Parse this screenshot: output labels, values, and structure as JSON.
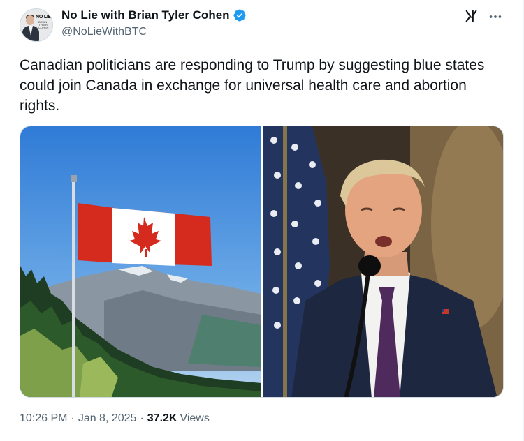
{
  "author": {
    "display_name": "No Lie with Brian Tyler Cohen",
    "handle": "@NoLieWithBTC",
    "avatar_text": "NO LIE",
    "avatar_subtext": "BRIAN TYLER COHEN",
    "verified": true
  },
  "tweet": {
    "text": "Canadian politicians are responding to Trump by suggesting blue states could join Canada in exchange for universal health care and abortion rights."
  },
  "media": {
    "images": [
      {
        "name": "canada-flag-photo",
        "description_icon": "canada-flag-mountains"
      },
      {
        "name": "trump-speaking-photo",
        "description_icon": "speaker-microphone"
      }
    ]
  },
  "meta": {
    "time": "10:26 PM",
    "date": "Jan 8, 2025",
    "views_count": "37.2K",
    "views_label": "Views"
  },
  "icons": {
    "verified": "verified-badge-icon",
    "grok": "grok-icon",
    "more": "more-options-icon"
  },
  "colors": {
    "text_primary": "#0f1419",
    "text_secondary": "#536471",
    "verified_blue": "#1d9bf0",
    "canada_red": "#d52b1e"
  }
}
